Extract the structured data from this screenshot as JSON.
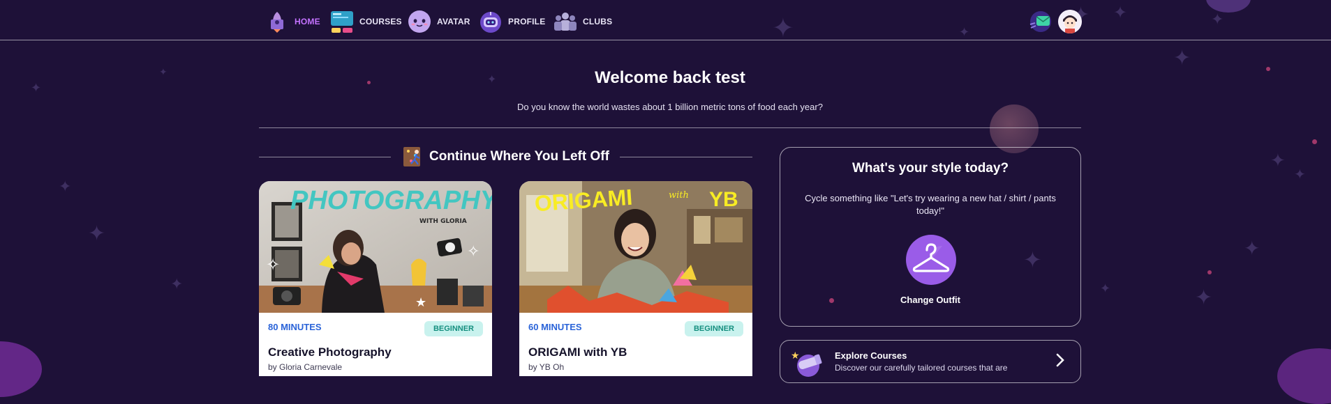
{
  "nav": {
    "items": [
      {
        "label": "HOME",
        "icon": "home-rocket-icon",
        "active": true
      },
      {
        "label": "COURSES",
        "icon": "courses-icon",
        "active": false
      },
      {
        "label": "AVATAR",
        "icon": "avatar-face-icon",
        "active": false
      },
      {
        "label": "PROFILE",
        "icon": "profile-robot-icon",
        "active": false
      },
      {
        "label": "CLUBS",
        "icon": "clubs-people-icon",
        "active": false
      }
    ],
    "active_color": "#c472ff"
  },
  "welcome": {
    "title": "Welcome back test",
    "fact": "Do you know the world wastes about 1 billion metric tons of food each year?"
  },
  "continue_section": {
    "title": "Continue Where You Left Off",
    "icon": "climber-icon"
  },
  "courses": [
    {
      "thumb_title": "PHOTOGRAPHY",
      "thumb_subtitle": "WITH GLORIA",
      "minutes": "80 MINUTES",
      "level": "BEGINNER",
      "title": "Creative Photography",
      "author": "by Gloria Carnevale"
    },
    {
      "thumb_title": "ORIGAMI",
      "thumb_with": "with",
      "thumb_name": "YB",
      "minutes": "60 MINUTES",
      "level": "BEGINNER",
      "title": "ORIGAMI with YB",
      "author": "by YB Oh"
    }
  ],
  "style_panel": {
    "title": "What's your style today?",
    "description": "Cycle something like \"Let's try wearing a new hat / shirt / pants today!\"",
    "icon": "hanger-icon",
    "button_label": "Change Outfit"
  },
  "explore_panel": {
    "title": "Explore Courses",
    "description": "Discover our carefully tailored courses that are",
    "icon": "telescope-icon"
  },
  "colors": {
    "background": "#1e1138",
    "accent": "#c472ff",
    "minutes": "#2a63d8",
    "level_bg": "#c9f2ee",
    "level_text": "#158f7f"
  }
}
